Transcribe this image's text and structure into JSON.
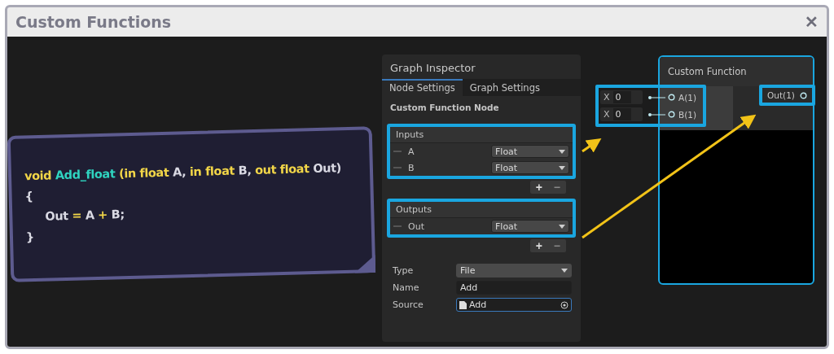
{
  "window": {
    "title": "Custom Functions",
    "close": "✕"
  },
  "code_note": {
    "lines": [
      {
        "indented": false,
        "tokens": [
          {
            "kind": "keyword",
            "text": "void"
          },
          {
            "kind": "function",
            "text": "Add_float"
          },
          {
            "kind": "keyword",
            "text": "(in float"
          },
          {
            "kind": "plain",
            "text": "A,"
          },
          {
            "kind": "keyword",
            "text": "in float"
          },
          {
            "kind": "plain",
            "text": "B,"
          },
          {
            "kind": "keyword",
            "text": "out float"
          },
          {
            "kind": "plain",
            "text": "Out)"
          }
        ]
      },
      {
        "indented": false,
        "tokens": [
          {
            "kind": "plain",
            "text": "{"
          }
        ]
      },
      {
        "indented": true,
        "tokens": [
          {
            "kind": "plain",
            "text": "Out"
          },
          {
            "kind": "keyword",
            "text": "="
          },
          {
            "kind": "plain",
            "text": "A"
          },
          {
            "kind": "keyword",
            "text": "+"
          },
          {
            "kind": "plain",
            "text": "B;"
          }
        ]
      },
      {
        "indented": false,
        "tokens": [
          {
            "kind": "plain",
            "text": "}"
          }
        ]
      }
    ]
  },
  "inspector": {
    "title": "Graph Inspector",
    "tabs": [
      {
        "label": "Node Settings",
        "selected": true
      },
      {
        "label": "Graph Settings",
        "selected": false
      }
    ],
    "section": "Custom Function Node",
    "groups": [
      {
        "title": "Inputs",
        "rows": [
          {
            "name": "A",
            "type": "Float"
          },
          {
            "name": "B",
            "type": "Float"
          }
        ],
        "add": "+",
        "remove": "−"
      },
      {
        "title": "Outputs",
        "rows": [
          {
            "name": "Out",
            "type": "Float"
          }
        ],
        "add": "+",
        "remove": "−"
      }
    ],
    "properties": [
      {
        "label": "Type",
        "kind": "dropdown",
        "value": "File"
      },
      {
        "label": "Name",
        "kind": "text",
        "value": "Add"
      },
      {
        "label": "Source",
        "kind": "object",
        "value": "Add"
      }
    ]
  },
  "node": {
    "title": "Custom Function",
    "inputs": [
      {
        "axis": "X",
        "value": "0",
        "port": "A(1)"
      },
      {
        "axis": "X",
        "value": "0",
        "port": "B(1)"
      }
    ],
    "outputs": [
      {
        "port": "Out(1)"
      }
    ]
  }
}
